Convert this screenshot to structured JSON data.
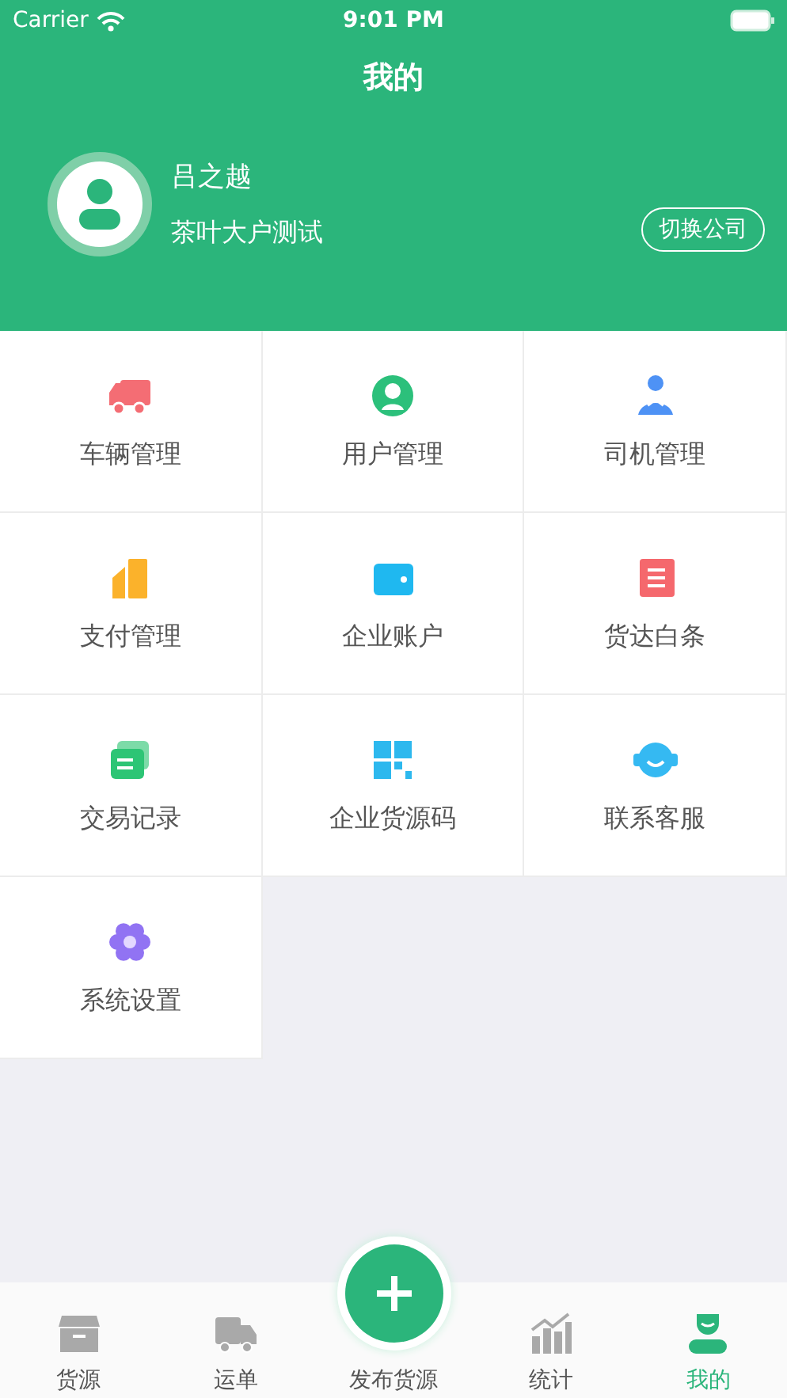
{
  "status_bar": {
    "carrier": "Carrier",
    "time": "9:01 PM"
  },
  "header": {
    "title": "我的"
  },
  "profile": {
    "name": "吕之越",
    "company": "茶叶大户测试",
    "switch_button": "切换公司"
  },
  "menu": [
    {
      "label": "车辆管理",
      "kind": "truck"
    },
    {
      "label": "用户管理",
      "kind": "user"
    },
    {
      "label": "司机管理",
      "kind": "driver"
    },
    {
      "label": "支付管理",
      "kind": "payment"
    },
    {
      "label": "企业账户",
      "kind": "wallet"
    },
    {
      "label": "货达白条",
      "kind": "note"
    },
    {
      "label": "交易记录",
      "kind": "records"
    },
    {
      "label": "企业货源码",
      "kind": "qrcode"
    },
    {
      "label": "联系客服",
      "kind": "service"
    },
    {
      "label": "系统设置",
      "kind": "settings"
    }
  ],
  "tab_bar": [
    {
      "label": "货源",
      "kind": "box",
      "selected": false
    },
    {
      "label": "运单",
      "kind": "van",
      "selected": false
    },
    {
      "label": "发布货源",
      "kind": "publish",
      "selected": false
    },
    {
      "label": "统计",
      "kind": "stats",
      "selected": false
    },
    {
      "label": "我的",
      "kind": "me",
      "selected": true
    }
  ]
}
